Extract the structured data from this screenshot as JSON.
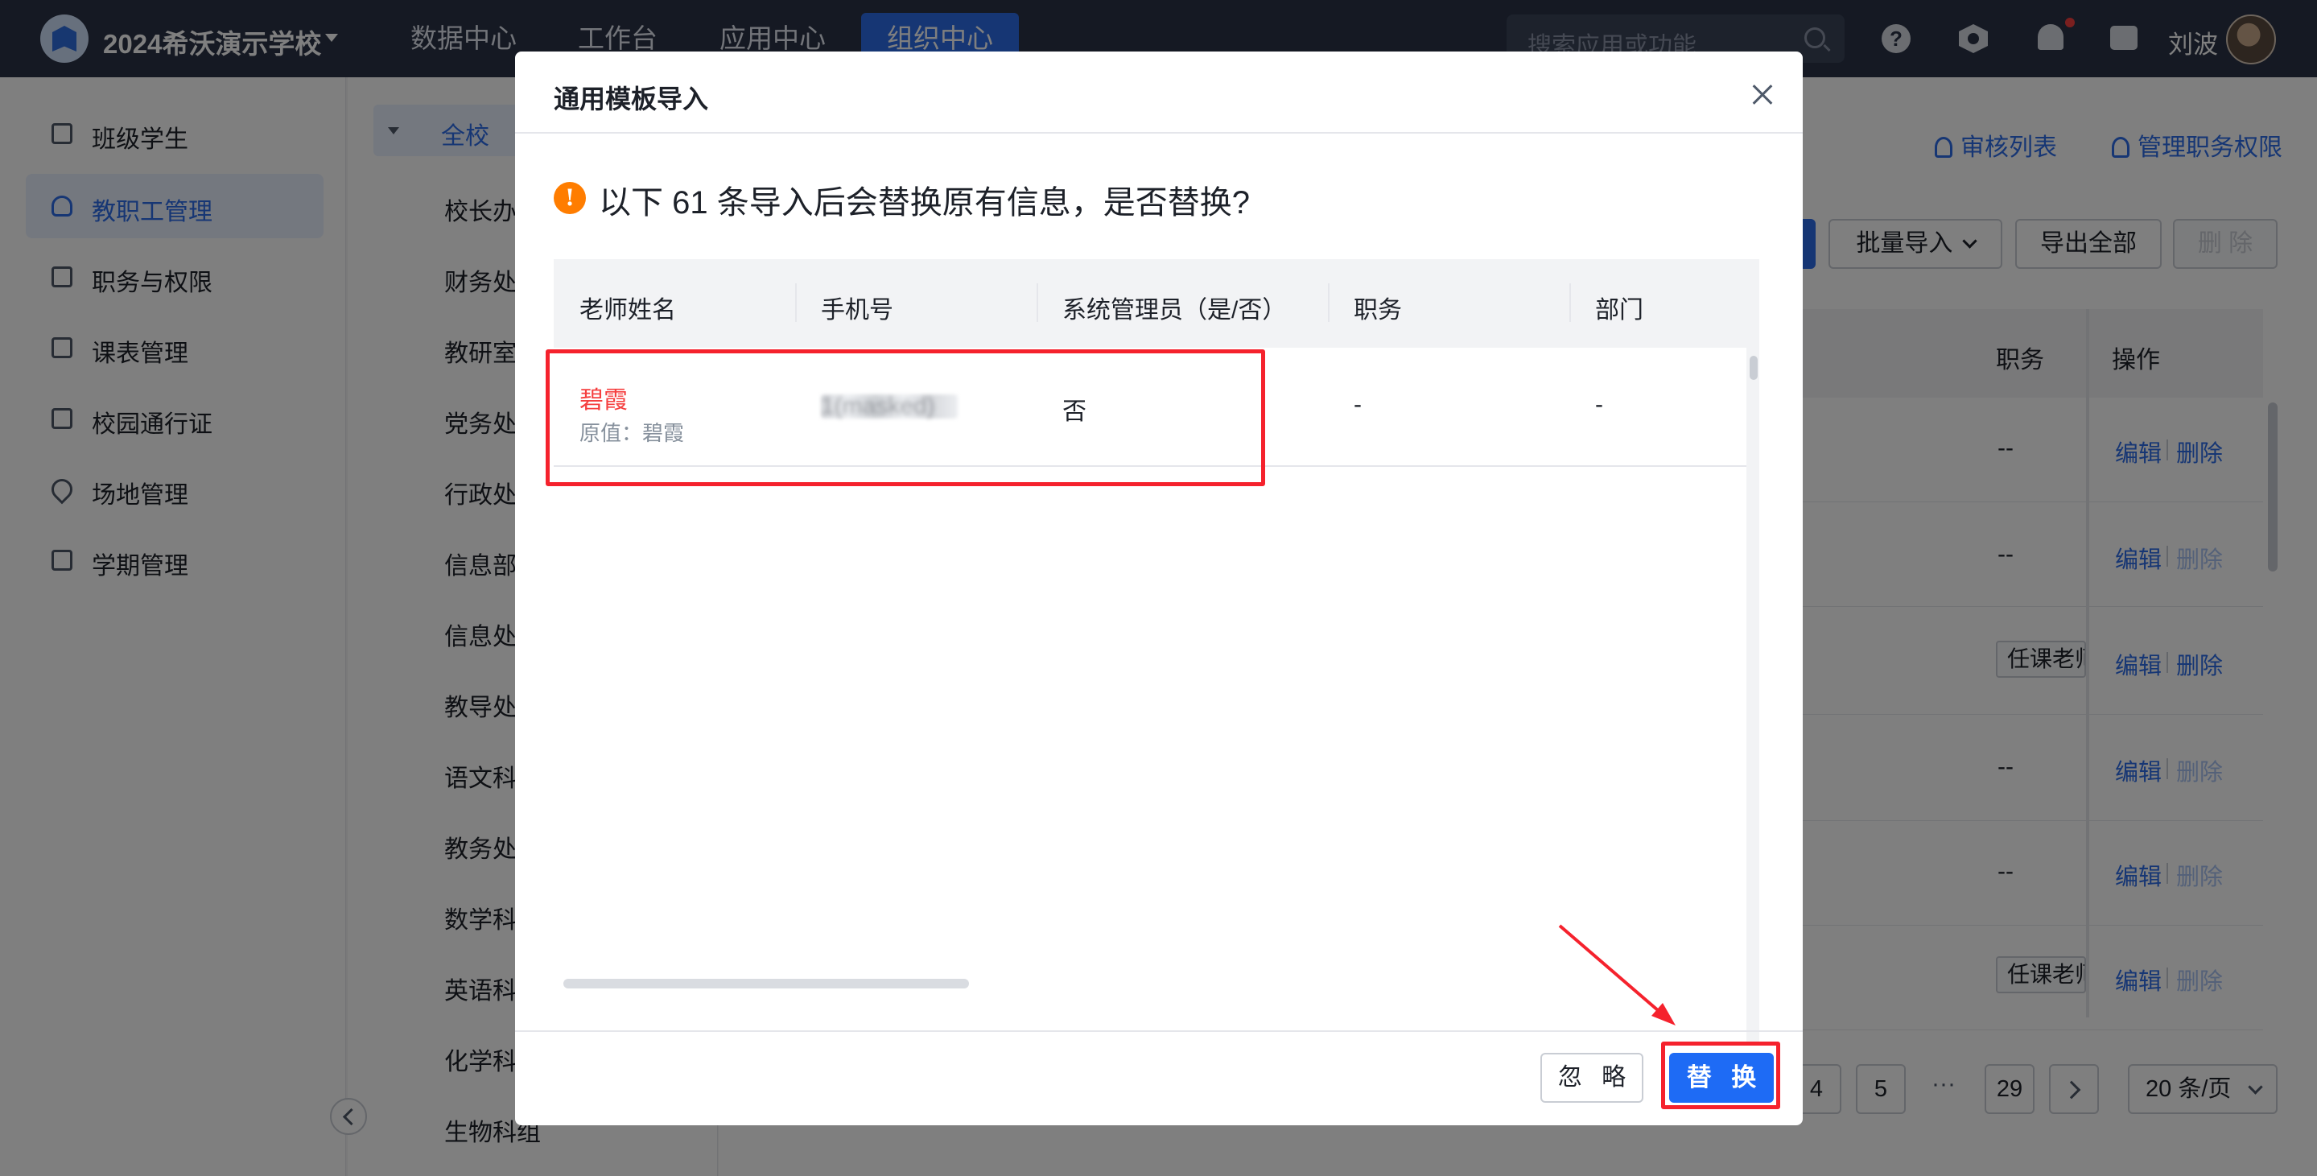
{
  "topbar": {
    "school_name": "2024希沃演示学校",
    "nav": [
      "数据中心",
      "工作台",
      "应用中心",
      "组织中心"
    ],
    "active_nav": "组织中心",
    "search_placeholder": "搜索应用或功能",
    "user_name": "刘波",
    "help_symbol": "?"
  },
  "sidebar": {
    "items": [
      "班级学生",
      "教职工管理",
      "职务与权限",
      "课表管理",
      "校园通行证",
      "场地管理",
      "学期管理"
    ],
    "active": "教职工管理"
  },
  "tree": {
    "root": "全校",
    "nodes": [
      "校长办公室",
      "财务处",
      "教研室",
      "党务处",
      "行政处",
      "信息部",
      "信息处",
      "教导处",
      "语文科组",
      "教务处",
      "数学科组",
      "英语科组",
      "化学科组",
      "生物科组"
    ]
  },
  "main": {
    "links": [
      "审核列表",
      "管理职务权限"
    ],
    "toolbar": {
      "batch_import": "批量导入",
      "export_all": "导出全部",
      "delete": "删 除"
    },
    "table_headers": {
      "post": "职务",
      "ops": "操作"
    },
    "rows": [
      {
        "post": "--",
        "edit": "编辑",
        "del": "删除",
        "del_enabled": true
      },
      {
        "post": "--",
        "edit": "编辑",
        "del": "删除",
        "del_enabled": false
      },
      {
        "post": "任课老师",
        "edit": "编辑",
        "del": "删除",
        "del_enabled": true
      },
      {
        "post": "--",
        "edit": "编辑",
        "del": "删除",
        "del_enabled": false
      },
      {
        "post": "--",
        "edit": "编辑",
        "del": "删除",
        "del_enabled": false
      },
      {
        "post": "任课老师",
        "edit": "编辑",
        "del": "删除",
        "del_enabled": false
      }
    ],
    "pagination": {
      "pages": [
        "4",
        "5"
      ],
      "ellipsis": "···",
      "last": "29",
      "page_size": "20 条/页"
    }
  },
  "modal": {
    "title": "通用模板导入",
    "warning": "以下 61 条导入后会替换原有信息，是否替换?",
    "warning_icon": "!",
    "columns": [
      "老师姓名",
      "手机号",
      "系统管理员（是/否）",
      "职务",
      "部门"
    ],
    "rows": [
      {
        "name": "碧霞",
        "original": "原值：碧霞",
        "phone": "1(masked)",
        "admin": "否",
        "post": "-",
        "dept": "-"
      }
    ],
    "ignore_label": "忽 略",
    "replace_label": "替 换"
  }
}
